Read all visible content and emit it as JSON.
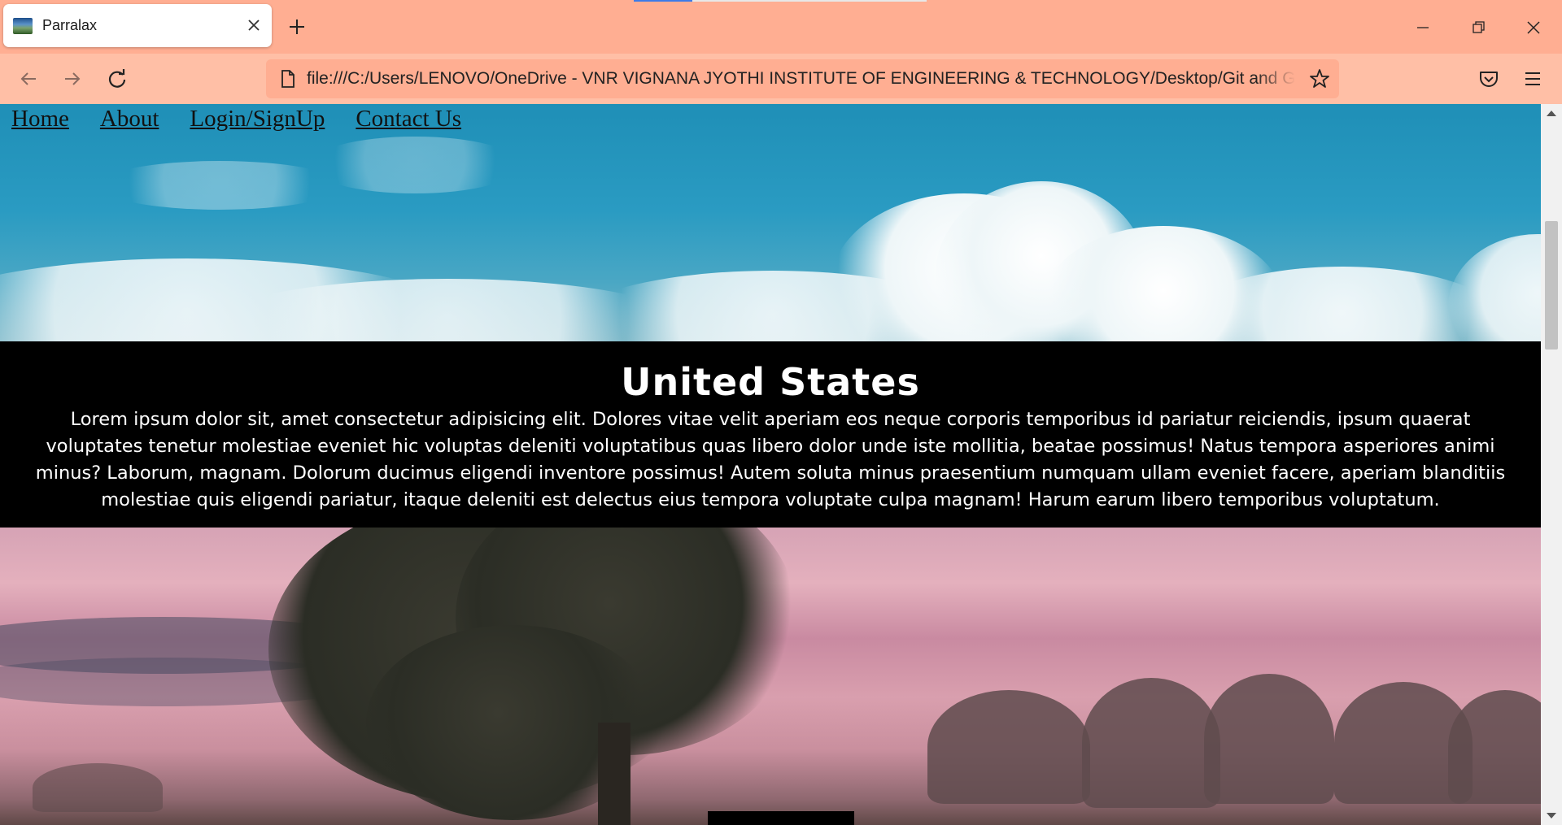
{
  "browser": {
    "tab_title": "Parralax",
    "url": "file:///C:/Users/LENOVO/OneDrive - VNR VIGNANA JYOTHI INSTITUTE OF ENGINEERING & TECHNOLOGY/Desktop/Git and GitHub/VN",
    "icons": {
      "back": "arrow-left-icon",
      "forward": "arrow-right-icon",
      "reload": "reload-icon",
      "page": "page-icon",
      "bookmark": "star-icon",
      "pocket": "pocket-icon",
      "menu": "hamburger-menu-icon",
      "close_tab": "close-icon",
      "new_tab": "plus-icon",
      "minimize": "minimize-icon",
      "restore": "restore-icon",
      "close_window": "close-icon"
    },
    "colors": {
      "tabbar": "#ffae92",
      "toolbar": "#ffbfa6",
      "loading_accent": "#3d7be8"
    }
  },
  "page": {
    "nav": [
      "Home",
      "About",
      "Login/SignUp",
      "Contact Us"
    ],
    "section": {
      "title": "United States",
      "body": "Lorem ipsum dolor sit, amet consectetur adipisicing elit. Dolores vitae velit aperiam eos neque corporis temporibus id pariatur reiciendis, ipsum quaerat voluptates tenetur molestiae eveniet hic voluptas deleniti voluptatibus quas libero dolor unde iste mollitia, beatae possimus! Natus tempora asperiores animi minus? Laborum, magnam. Dolorum ducimus eligendi inventore possimus! Autem soluta minus praesentium numquam ullam eveniet facere, aperiam blanditiis molestiae quis eligendi pariatur, itaque deleniti est delectus eius tempora voluptate culpa magnam! Harum earum libero temporibus voluptatum."
    },
    "images": [
      "sky-with-clouds",
      "tree-at-sunrise"
    ]
  }
}
